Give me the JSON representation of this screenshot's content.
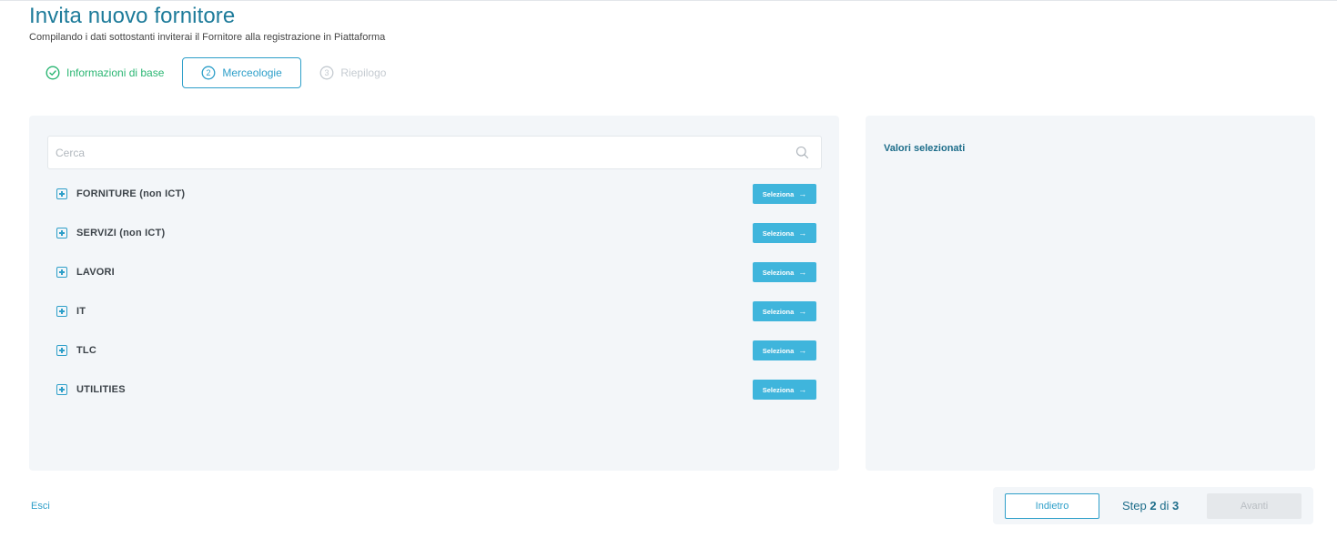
{
  "page": {
    "title": "Invita nuovo fornitore",
    "subtitle": "Compilando i dati sottostanti inviterai il Fornitore alla registrazione in Piattaforma"
  },
  "steps": [
    {
      "label": "Informazioni di base",
      "state": "completed",
      "number": "1"
    },
    {
      "label": "Merceologie",
      "state": "active",
      "number": "2"
    },
    {
      "label": "Riepilogo",
      "state": "pending",
      "number": "3"
    }
  ],
  "search": {
    "placeholder": "Cerca",
    "value": ""
  },
  "categories": [
    {
      "label": "FORNITURE (non ICT)",
      "button": "Seleziona"
    },
    {
      "label": "SERVIZI (non ICT)",
      "button": "Seleziona"
    },
    {
      "label": "LAVORI",
      "button": "Seleziona"
    },
    {
      "label": "IT",
      "button": "Seleziona"
    },
    {
      "label": "TLC",
      "button": "Seleziona"
    },
    {
      "label": "UTILITIES",
      "button": "Seleziona"
    }
  ],
  "selected_panel": {
    "title": "Valori selezionati"
  },
  "footer": {
    "exit_label": "Esci",
    "back_label": "Indietro",
    "step_prefix": "Step",
    "step_current": "2",
    "step_separator": "di",
    "step_total": "3",
    "next_label": "Avanti"
  },
  "colors": {
    "accent": "#2e9fc9",
    "title": "#1d7b9a",
    "success": "#2bb673",
    "button": "#3fb5dc",
    "panel": "#f3f6f9"
  },
  "icons": {
    "step_completed": "check-circle-icon",
    "search": "search-icon",
    "expand": "plus-square-icon",
    "select_arrow": "arrow-right-icon"
  }
}
